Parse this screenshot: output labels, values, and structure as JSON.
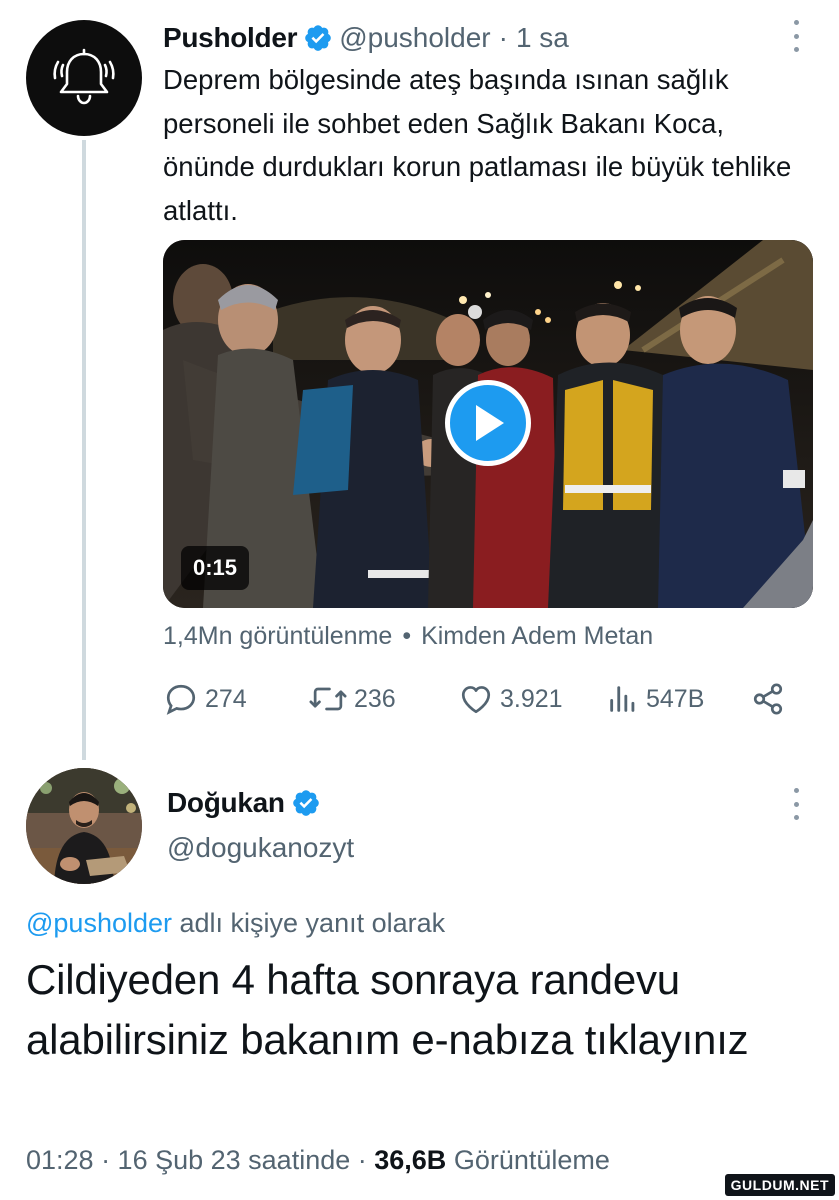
{
  "tweet1": {
    "name": "Pusholder",
    "handle": "@pusholder",
    "time": "1 sa",
    "separator": "·",
    "text": "Deprem bölgesinde ateş başında ısınan sağlık personeli ile sohbet eden Sağlık Bakanı Koca, önünde durdukları korun patlaması ile büyük tehlike atlattı.",
    "video": {
      "duration": "0:15"
    },
    "views": "1,4Mn görüntülenme",
    "bullet": "•",
    "source": "Kimden Adem Metan",
    "actions": {
      "replies": "274",
      "retweets": "236",
      "likes": "3.921",
      "views": "547B"
    }
  },
  "tweet2": {
    "name": "Doğukan",
    "handle": "@dogukanozyt",
    "reply_mention": "@pusholder",
    "reply_suffix": " adlı kişiye yanıt olarak",
    "text": "Cildiyeden 4 hafta sonraya randevu alabilirsiniz bakanım e-nabıza tıklayınız",
    "timestamp": "01:28 · 16 Şub 23 saatinde · ",
    "view_count": "36,6B",
    "view_label": " Görüntüleme"
  },
  "watermark": "GULDUM.NET",
  "icons": {
    "avatar1": "bell-icon",
    "verified": "verified-badge-icon",
    "more": "more-options-icon",
    "play": "play-icon",
    "reply": "reply-icon",
    "retweet": "retweet-icon",
    "like": "like-icon",
    "views": "views-icon",
    "share": "share-icon"
  },
  "colors": {
    "accent": "#1d9bf0",
    "text": "#0f1419",
    "secondary": "#536471",
    "thread_line": "#cfd9de"
  }
}
